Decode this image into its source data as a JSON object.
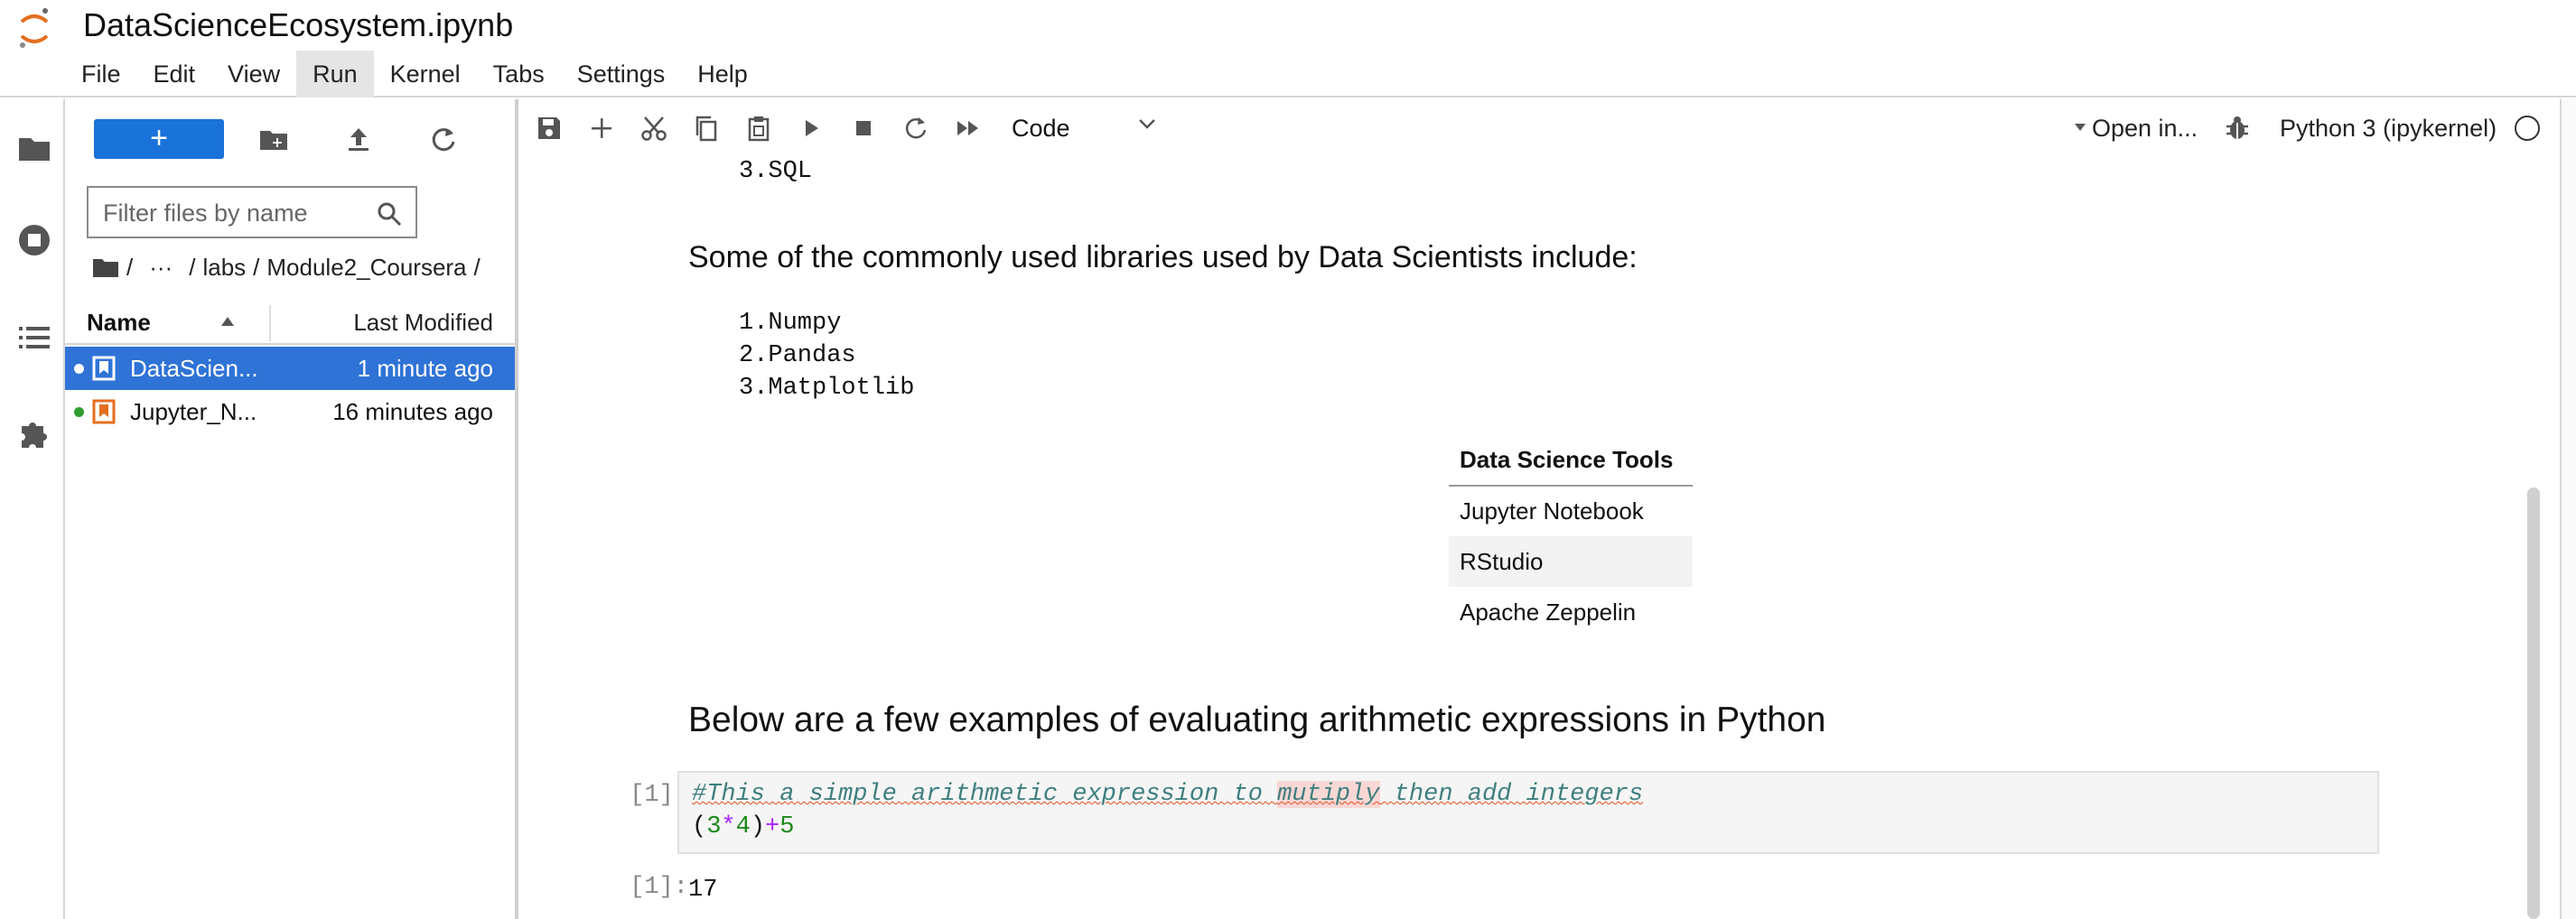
{
  "app": {
    "document_title": "DataScienceEcosystem.ipynb"
  },
  "menu": [
    {
      "label": "File"
    },
    {
      "label": "Edit"
    },
    {
      "label": "View"
    },
    {
      "label": "Run",
      "active": true
    },
    {
      "label": "Kernel"
    },
    {
      "label": "Tabs"
    },
    {
      "label": "Settings"
    },
    {
      "label": "Help"
    }
  ],
  "activity_bar": [
    "folder-icon",
    "running-icon",
    "toc-icon",
    "extension-icon"
  ],
  "file_browser": {
    "new_button_label": "+",
    "filter_placeholder": "Filter files by name",
    "breadcrumb": {
      "root": "/",
      "ellipsis": "···",
      "parts": [
        "labs",
        "Module2_Coursera"
      ],
      "sep": "/"
    },
    "columns": {
      "name": "Name",
      "modified": "Last Modified"
    },
    "files": [
      {
        "name": "DataScien...",
        "modified": "1 minute ago",
        "selected": true
      },
      {
        "name": "Jupyter_N...",
        "modified": "16 minutes ago",
        "selected": false
      }
    ]
  },
  "toolbar": {
    "cell_type": "Code",
    "open_in": "Open in...",
    "kernel": "Python 3 (ipykernel)"
  },
  "notebook": {
    "list_tail": [
      "3.SQL"
    ],
    "libraries_intro": "Some of the commonly used libraries used by Data Scientists include:",
    "libraries": [
      "1.Numpy",
      "2.Pandas",
      "3.Matplotlib"
    ],
    "tools_table": {
      "header": "Data Science Tools",
      "rows": [
        "Jupyter Notebook",
        "RStudio",
        "Apache Zeppelin"
      ]
    },
    "arith_heading": "Below are a few examples of evaluating arithmetic expressions in Python",
    "code_cell": {
      "prompt": "[1]:",
      "comment_before": "#This a simple arithmetic expression to ",
      "comment_typo": "mutiply",
      "comment_after": " then add integers",
      "expr": {
        "open": "(",
        "a": "3",
        "mul": "*",
        "b": "4",
        "close": ")",
        "plus": "+",
        "c": "5"
      }
    },
    "output": {
      "prompt": "[1]:",
      "value": "17"
    }
  },
  "colors": {
    "accent_blue": "#1a73d9",
    "selection_blue": "#2f73d6",
    "dot_green": "#2e9e2e",
    "notebook_orange": "#e46e1f"
  }
}
